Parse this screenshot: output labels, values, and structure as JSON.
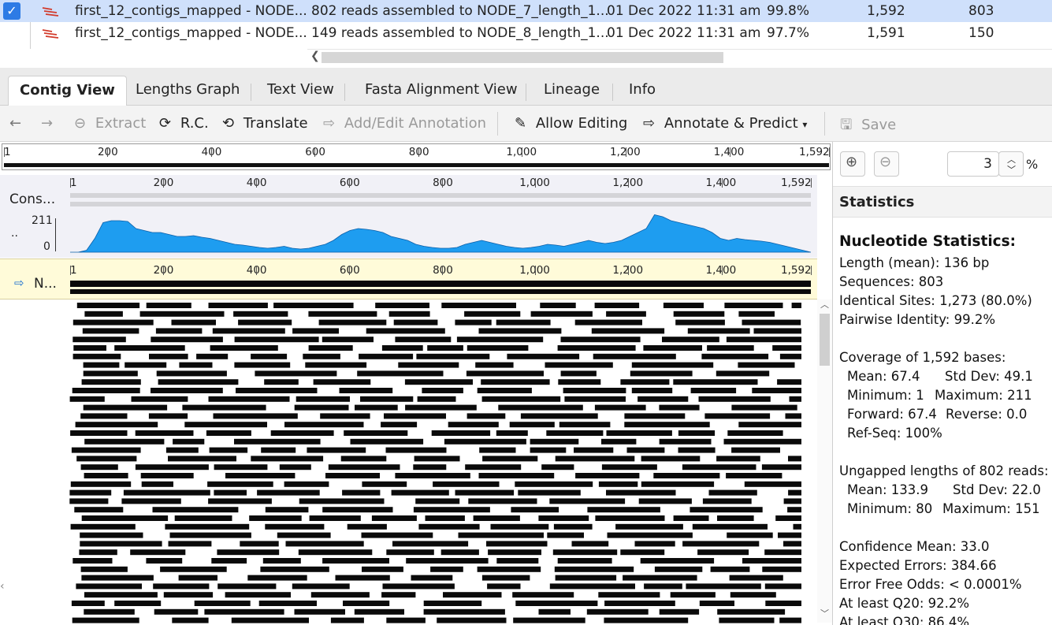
{
  "documents": [
    {
      "name": "first_12_contigs_mapped - NODE...",
      "description": "802 reads assembled to NODE_7_length_1...",
      "modified": "01 Dec 2022 11:31 am",
      "pct": "99.8%",
      "length": "1,592",
      "sequences": "803",
      "selected": true
    },
    {
      "name": "first_12_contigs_mapped - NODE...",
      "description": "149 reads assembled to NODE_8_length_1...",
      "modified": "01 Dec 2022 11:31 am",
      "pct": "97.7%",
      "length": "1,591",
      "sequences": "150",
      "selected": false
    }
  ],
  "tabs": [
    "Contig View",
    "Lengths Graph",
    "Text View",
    "Fasta Alignment View",
    "Lineage",
    "Info"
  ],
  "active_tab": "Contig View",
  "toolbar": {
    "extract": "Extract",
    "rc": "R.C.",
    "translate": "Translate",
    "add_annotation": "Add/Edit Annotation",
    "allow_editing": "Allow Editing",
    "annotate_predict": "Annotate & Predict",
    "save": "Save"
  },
  "ruler_ticks": [
    "1",
    "200",
    "400",
    "600",
    "800",
    "1,000",
    "1,200",
    "1,400",
    "1,592"
  ],
  "track_labels": {
    "consensus": "Cons...",
    "coverage_max": "211",
    "coverage_min": "0",
    "coverage_dots": "..",
    "reference": "N..."
  },
  "zoom": {
    "value": "3",
    "unit": "%"
  },
  "statistics": {
    "header": "Statistics",
    "nucleotide_title": "Nucleotide Statistics:",
    "length_mean": "Length (mean): 136 bp",
    "sequences": "Sequences: 803",
    "identical_sites": "Identical Sites: 1,273 (80.0%)",
    "pairwise_identity": "Pairwise Identity: 99.2%",
    "coverage_title": "Coverage of 1,592 bases:",
    "cov_mean": "Mean: 67.4",
    "cov_std": "Std Dev: 49.1",
    "cov_min": "Minimum: 1",
    "cov_max": "Maximum: 211",
    "cov_forward": "Forward: 67.4",
    "cov_reverse": "Reverse: 0.0",
    "ref_seq": "Ref-Seq: 100%",
    "ungapped_title": "Ungapped lengths of 802 reads:",
    "ug_mean": "Mean: 133.9",
    "ug_std": "Std Dev: 22.0",
    "ug_min": "Minimum: 80",
    "ug_max": "Maximum: 151",
    "confidence_mean": "Confidence Mean: 33.0",
    "expected_errors": "Expected Errors: 384.66",
    "error_free_odds": "Error Free Odds: < 0.0001%",
    "q20": "At least Q20: 92.2%",
    "q30": "At least Q30: 86.4%"
  },
  "colors": {
    "coverage": "#1e9df0",
    "reads": "#0a0a0a",
    "selection": "#cfe0fb",
    "reference_bg": "#fffbd9"
  }
}
